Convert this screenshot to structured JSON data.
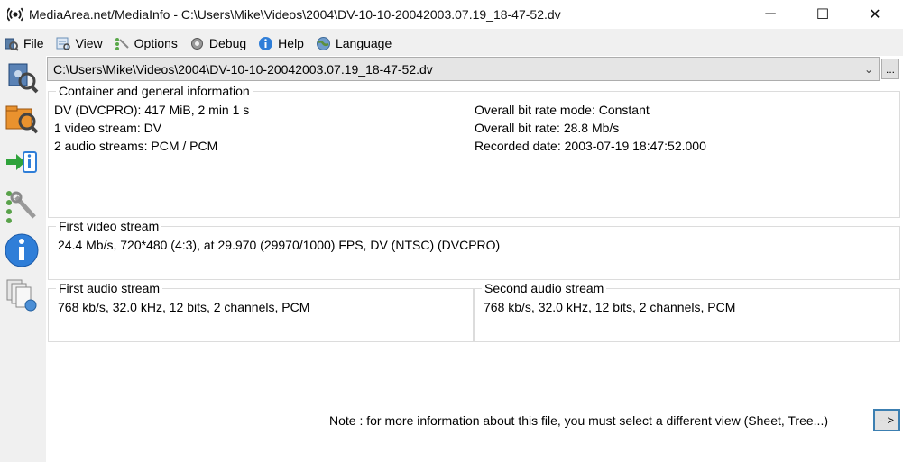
{
  "window": {
    "title": "MediaArea.net/MediaInfo - C:\\Users\\Mike\\Videos\\2004\\DV-10-10-20042003.07.19_18-47-52.dv",
    "minimize_glyph": "─",
    "maximize_glyph": "☐",
    "close_glyph": "✕"
  },
  "menu": {
    "items": [
      {
        "label": "File",
        "icon": "file-icon"
      },
      {
        "label": "View",
        "icon": "view-icon"
      },
      {
        "label": "Options",
        "icon": "options-icon"
      },
      {
        "label": "Debug",
        "icon": "debug-gear-icon"
      },
      {
        "label": "Help",
        "icon": "help-icon"
      },
      {
        "label": "Language",
        "icon": "language-globe-icon"
      }
    ]
  },
  "toolbar": {
    "tools": [
      "open-file-icon",
      "open-folder-icon",
      "export-icon",
      "preferences-icon",
      "about-info-icon",
      "knowledge-base-icon"
    ]
  },
  "file_selector": {
    "value": "C:\\Users\\Mike\\Videos\\2004\\DV-10-10-20042003.07.19_18-47-52.dv",
    "dropdown_glyph": "⌄",
    "browse_label": "..."
  },
  "general": {
    "title": "Container and general information",
    "left_lines": [
      "DV (DVCPRO): 417 MiB, 2 min 1 s",
      "1 video stream: DV",
      "2 audio streams: PCM / PCM"
    ],
    "right_lines": [
      "Overall bit rate mode: Constant",
      "Overall bit rate: 28.8 Mb/s",
      "Recorded date: 2003-07-19 18:47:52.000"
    ]
  },
  "video": {
    "title": "First video stream",
    "line": "24.4 Mb/s, 720*480 (4:3), at 29.970 (29970/1000) FPS, DV (NTSC) (DVCPRO)"
  },
  "audio1": {
    "title": "First audio stream",
    "line": "768 kb/s, 32.0 kHz, 12 bits, 2 channels, PCM"
  },
  "audio2": {
    "title": "Second audio stream",
    "line": "768 kb/s, 32.0 kHz, 12 bits, 2 channels, PCM"
  },
  "footer": {
    "note": "Note : for more information about this file, you must select a different view (Sheet, Tree...)",
    "arrow_label": "-->"
  },
  "colors": {
    "focus_border": "#3c7fb1",
    "group_border": "#dcdcdc",
    "chrome_background": "#f0f0f0"
  }
}
